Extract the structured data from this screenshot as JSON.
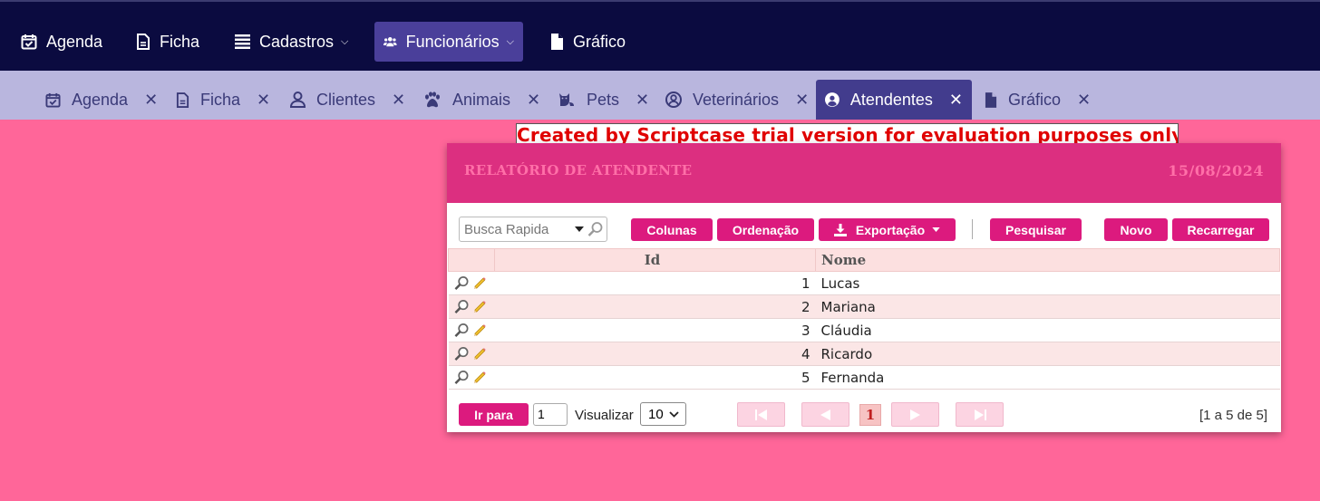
{
  "topnav": {
    "items": [
      {
        "label": "Agenda",
        "icon": "calendar-check-icon"
      },
      {
        "label": "Ficha",
        "icon": "file-icon"
      },
      {
        "label": "Cadastros",
        "icon": "list-icon"
      },
      {
        "label": "Funcionários",
        "icon": "users-icon"
      },
      {
        "label": "Gráfico",
        "icon": "file-solid-icon"
      }
    ]
  },
  "tabs": [
    {
      "label": "Agenda",
      "icon": "calendar-check-icon"
    },
    {
      "label": "Ficha",
      "icon": "file-icon"
    },
    {
      "label": "Clientes",
      "icon": "user-icon"
    },
    {
      "label": "Animais",
      "icon": "paw-icon"
    },
    {
      "label": "Pets",
      "icon": "cat-icon"
    },
    {
      "label": "Veterinários",
      "icon": "user-circle-icon"
    },
    {
      "label": "Atendentes",
      "icon": "user-circle-solid-icon"
    },
    {
      "label": "Gráfico",
      "icon": "file-solid-icon"
    }
  ],
  "trial_notice": "Created by Scriptcase trial version for evaluation purposes only.",
  "report": {
    "title": "RELATÓRIO DE ATENDENTE",
    "date": "15/08/2024",
    "search_placeholder": "Busca Rapida",
    "buttons": {
      "colunas": "Colunas",
      "ordenacao": "Ordenação",
      "exportacao": "Exportação",
      "pesquisar": "Pesquisar",
      "novo": "Novo",
      "recarregar": "Recarregar"
    },
    "columns": {
      "id": "Id",
      "nome": "Nome"
    },
    "rows": [
      {
        "id": "1",
        "nome": "Lucas"
      },
      {
        "id": "2",
        "nome": "Mariana"
      },
      {
        "id": "3",
        "nome": "Cláudia"
      },
      {
        "id": "4",
        "nome": "Ricardo"
      },
      {
        "id": "5",
        "nome": "Fernanda"
      }
    ],
    "footer": {
      "goto_label": "Ir para",
      "goto_value": "1",
      "visualizar_label": "Visualizar",
      "page_size": "10",
      "current_page": "1",
      "summary": "[1 a 5 de 5]"
    }
  },
  "colors": {
    "navbar": "#0b0b40",
    "active_nav": "#4a3f9a",
    "tabbar": "#b9b6de",
    "background": "#ff6699",
    "header": "#dc2f80",
    "button": "#dc1a7e"
  }
}
